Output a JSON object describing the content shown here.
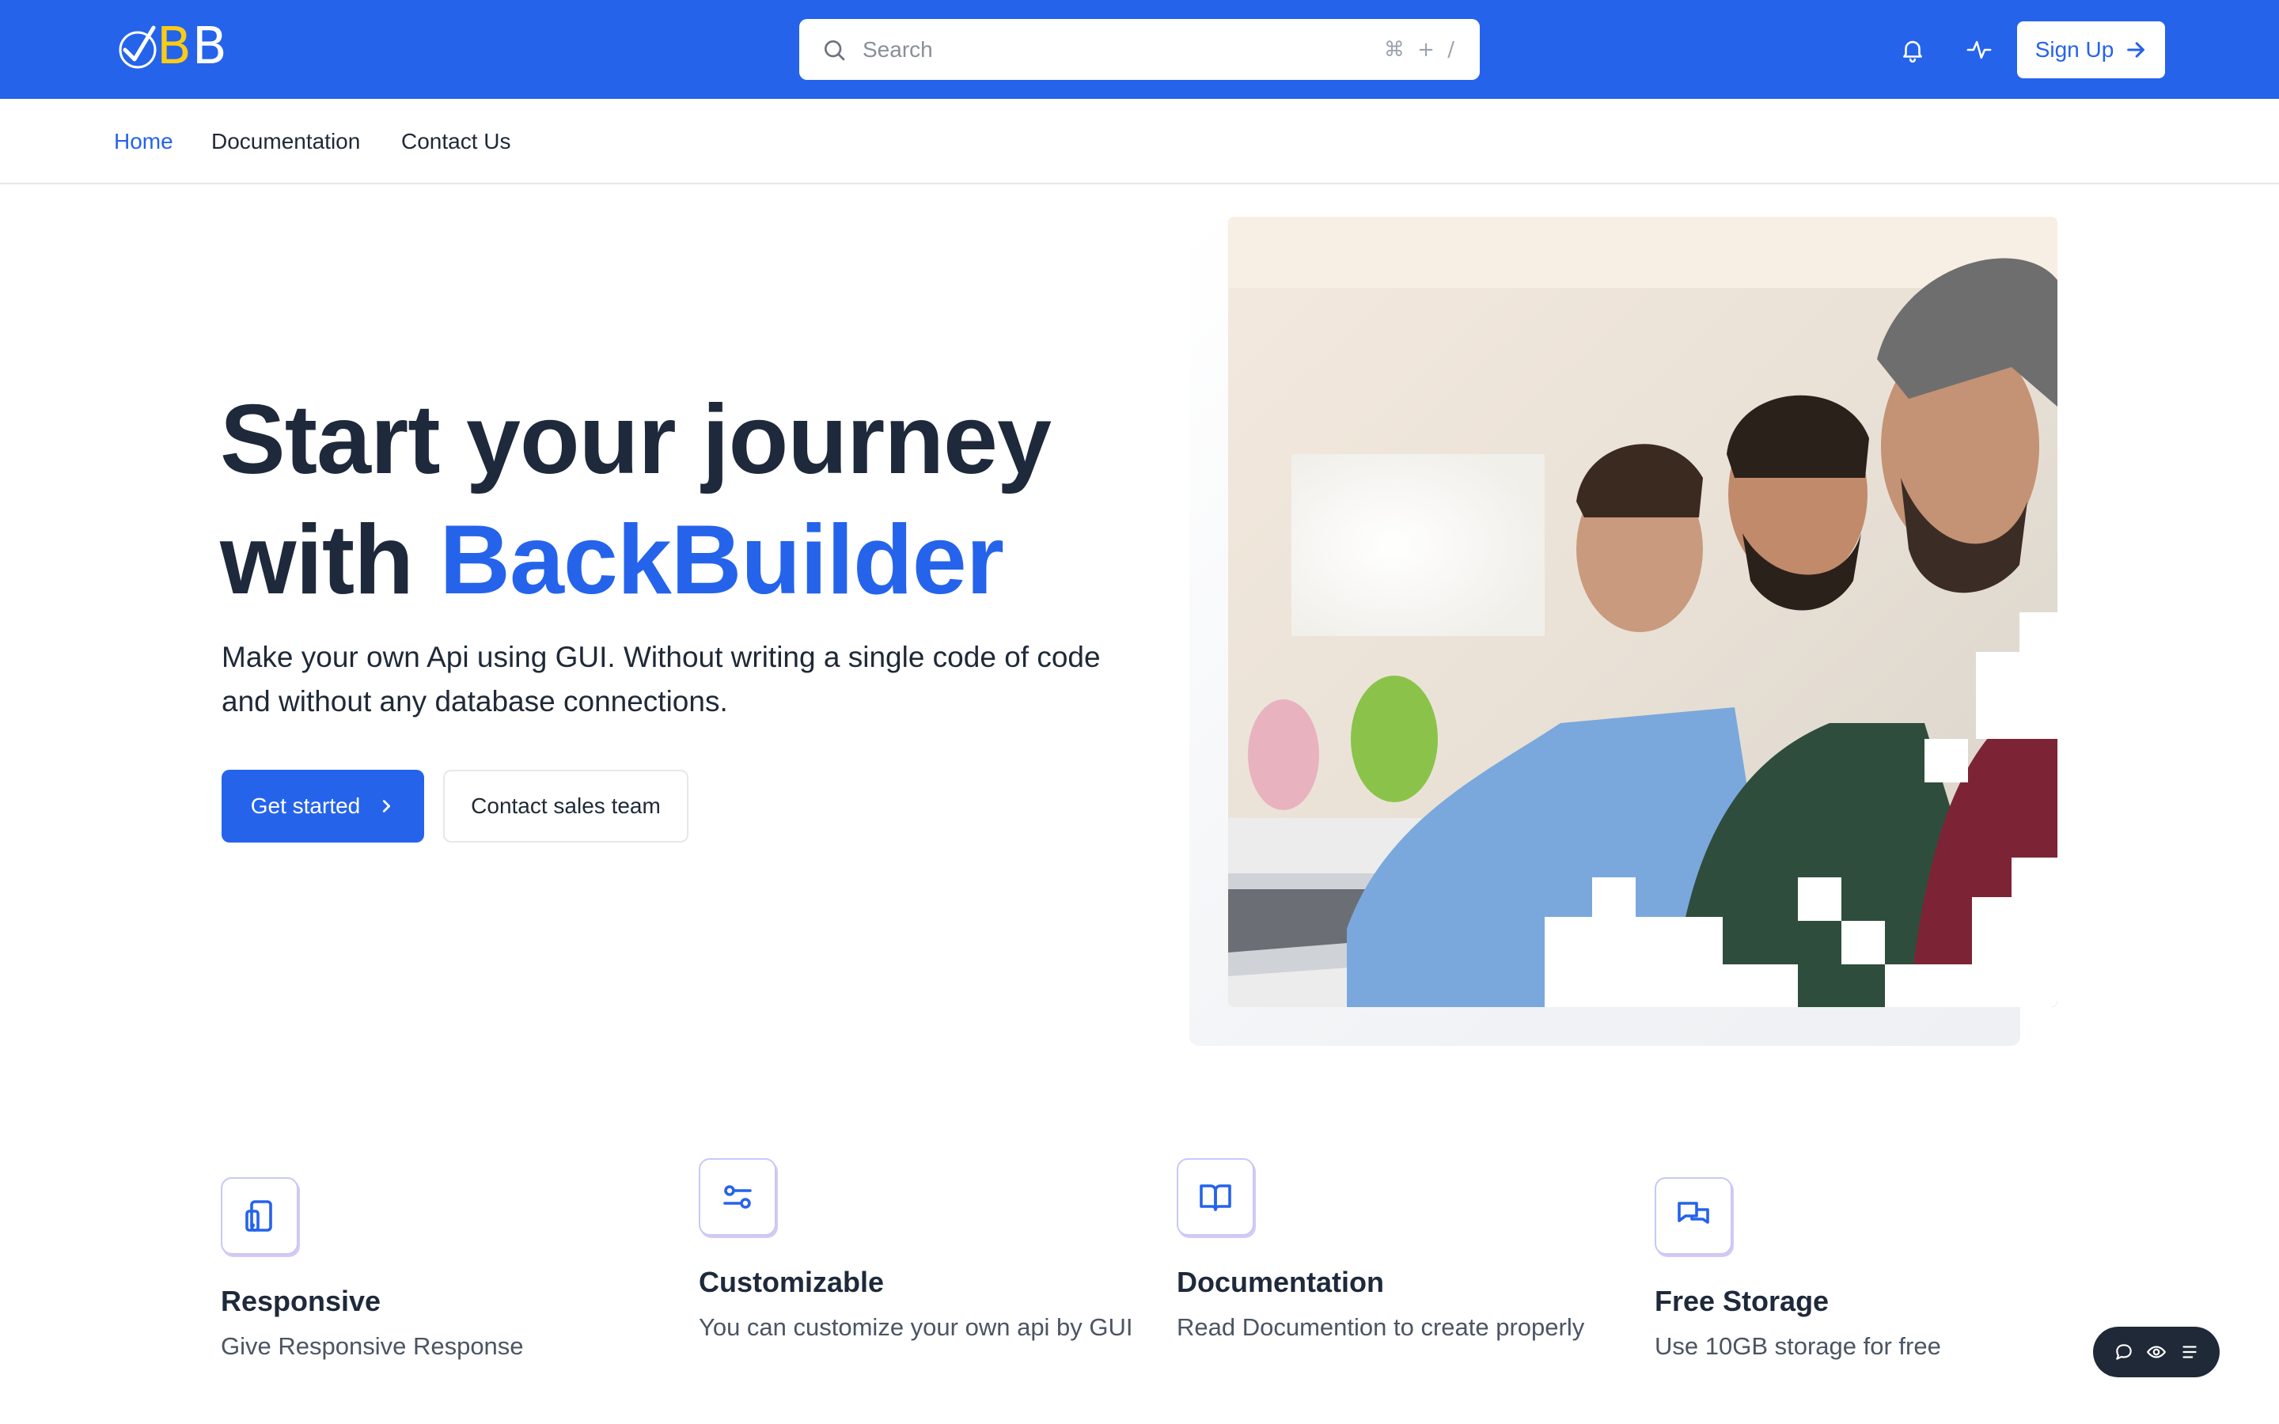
{
  "brand": {
    "logo_letters": "BB"
  },
  "search": {
    "placeholder": "Search",
    "shortcut": "⌘ + /"
  },
  "header": {
    "signup_label": "Sign Up"
  },
  "nav": {
    "items": [
      {
        "label": "Home",
        "active": true
      },
      {
        "label": "Documentation"
      },
      {
        "label": "Contact Us"
      }
    ]
  },
  "hero": {
    "title_line1": "Start your journey",
    "title_line2_prefix": "with ",
    "title_line2_accent": "BackBuilder",
    "subtitle": "Make your own Api using GUI. Without writing a single code of code and without any database connections.",
    "primary_cta": "Get started",
    "secondary_cta": "Contact sales team"
  },
  "features": [
    {
      "icon": "tablet-icon",
      "title": "Responsive",
      "description": "Give Responsive Response"
    },
    {
      "icon": "sliders-icon",
      "title": "Customizable",
      "description": "You can customize your own api by GUI"
    },
    {
      "icon": "book-icon",
      "title": "Documentation",
      "description": "Read Documention to create properly"
    },
    {
      "icon": "chat-icon",
      "title": "Free Storage",
      "description": "Use 10GB storage for free"
    }
  ],
  "colors": {
    "primary": "#2563eb",
    "logo_accent": "#facc15",
    "heading": "#1e293b"
  }
}
